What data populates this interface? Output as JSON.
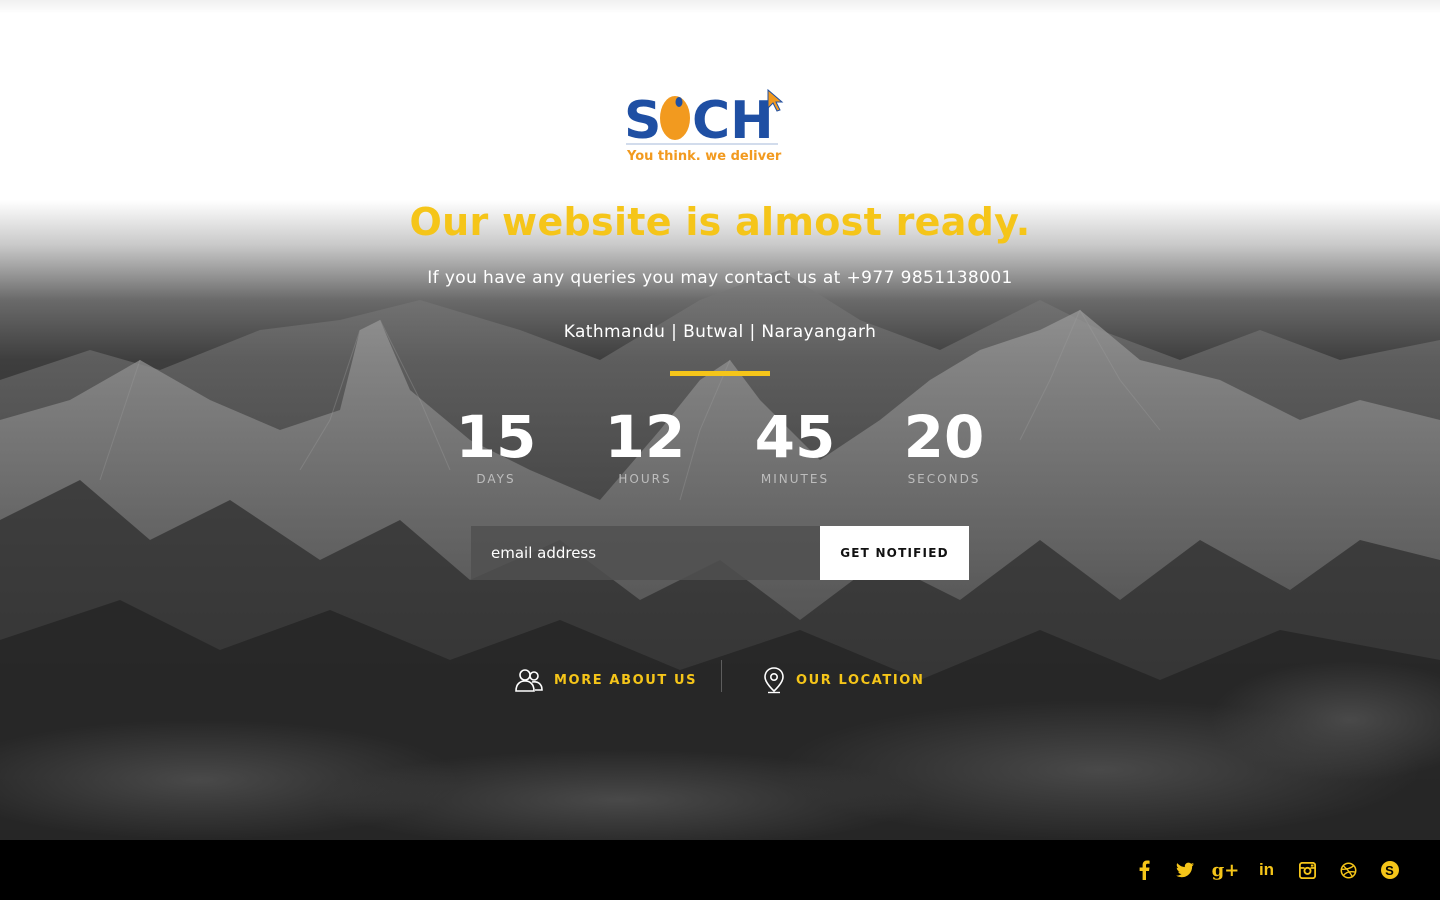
{
  "logo": {
    "brand_text": "SOCH",
    "tagline": "You think. we deliver",
    "colors": {
      "blue": "#1f4fa3",
      "orange": "#f29a1f"
    }
  },
  "hero": {
    "headline": "Our website is almost ready.",
    "contact_line": "If you have any queries you may contact us at +977 9851138001",
    "cities": "Kathmandu | Butwal | Narayangarh"
  },
  "countdown": [
    {
      "value": "15",
      "label": "DAYS"
    },
    {
      "value": "12",
      "label": "HOURS"
    },
    {
      "value": "45",
      "label": "MINUTES"
    },
    {
      "value": "20",
      "label": "SECONDS"
    }
  ],
  "notify": {
    "email_placeholder": "email address",
    "button_label": "GET NOTIFIED"
  },
  "links": {
    "about": {
      "label": "MORE ABOUT US",
      "icon": "users-icon"
    },
    "location": {
      "label": "OUR LOCATION",
      "icon": "map-pin-icon"
    }
  },
  "social": [
    {
      "name": "facebook-icon",
      "glyph": "f"
    },
    {
      "name": "twitter-icon",
      "glyph": ""
    },
    {
      "name": "google-plus-icon",
      "glyph": "g+"
    },
    {
      "name": "linkedin-icon",
      "glyph": "in"
    },
    {
      "name": "instagram-icon",
      "glyph": ""
    },
    {
      "name": "dribbble-icon",
      "glyph": ""
    },
    {
      "name": "skype-icon",
      "glyph": "S"
    }
  ],
  "colors": {
    "accent": "#f5c519",
    "footer_bg": "#000000",
    "button_bg": "#ffffff"
  }
}
